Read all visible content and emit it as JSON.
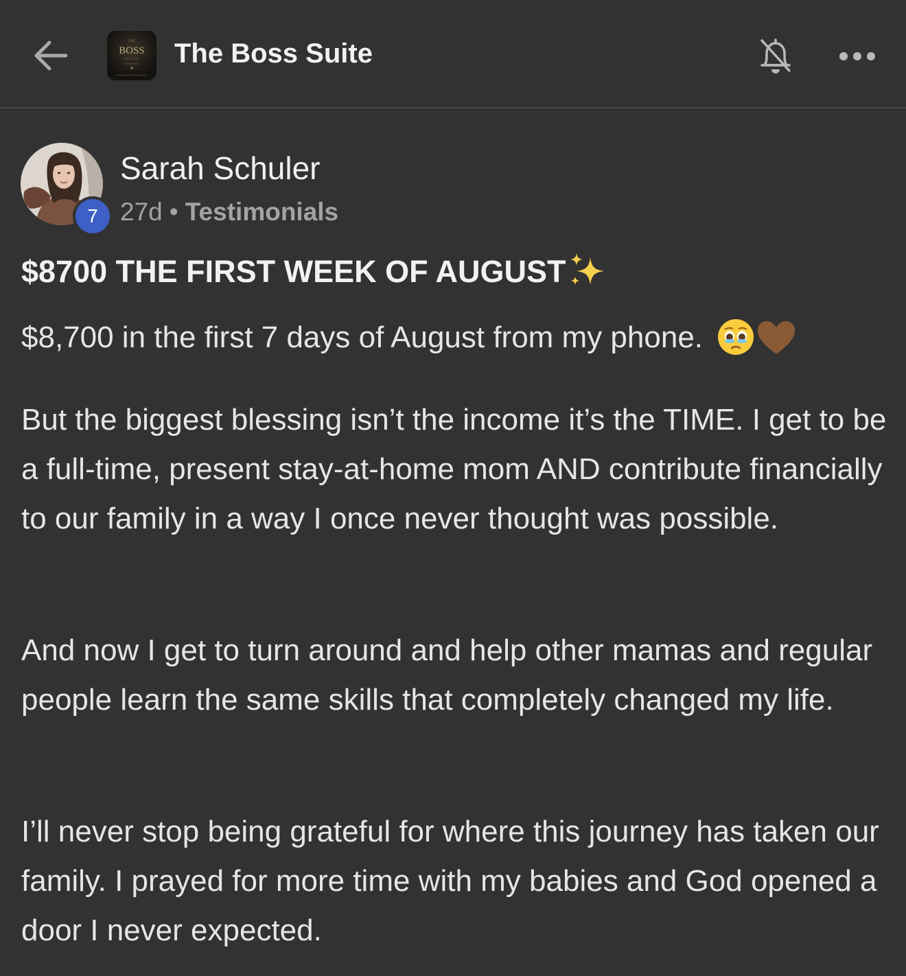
{
  "header": {
    "back_label": "Back",
    "group_name": "The Boss Suite",
    "logo_text": "BOSS"
  },
  "post": {
    "author": {
      "name": "Sarah Schuler",
      "level": "7"
    },
    "age": "27d",
    "separator": "•",
    "category": "Testimonials",
    "title": "$8700 THE FIRST WEEK OF AUGUST",
    "paragraphs": [
      "$8,700 in the first 7 days of August from my phone.",
      "But the biggest blessing isn’t the income it’s the TIME. I get to be a full-time, present stay-at-home mom AND contribute financially to our family in a way I once never thought was possible.",
      "And now I get to turn around and help other mamas and regular people learn the same skills that completely changed my life.",
      "I’ll never stop being grateful for where this journey has taken our family. I prayed for more time with my babies and God opened a door I never expected."
    ]
  },
  "icons": {
    "back": "arrow-left-icon",
    "notifications": "bell-off-icon",
    "more": "more-horizontal-icon",
    "title_emoji": "sparkles-icon",
    "p1_emoji_1": "holding-back-tears-face-icon",
    "p1_emoji_2": "brown-heart-icon"
  },
  "colors": {
    "background": "#323232",
    "divider": "#4a4a4a",
    "text_primary": "#e6e6e6",
    "text_secondary": "#a3a3a3",
    "level_badge": "#3d5fc6"
  }
}
